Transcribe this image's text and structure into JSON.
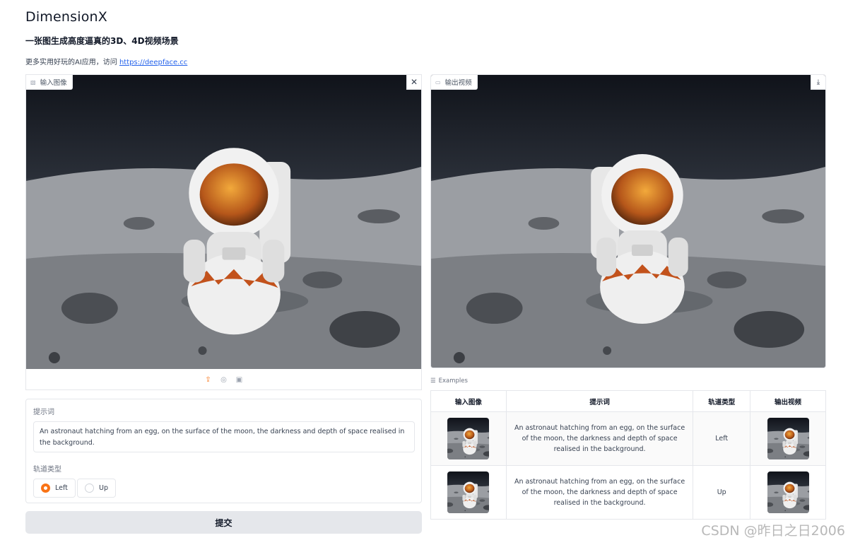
{
  "app": {
    "title": "DimensionX",
    "subtitle": "一张图生成高度逼真的3D、4D视频场景",
    "more_prefix": "更多实用好玩的AI应用，访问 ",
    "more_link": "https://deepface.cc"
  },
  "input_panel": {
    "label": "输入图像",
    "icon": "image-icon",
    "clear_icon": "close-icon"
  },
  "output_panel": {
    "label": "输出视频",
    "icon": "video-icon",
    "download_icon": "download-icon"
  },
  "toolbar": {
    "icons": [
      "upload-icon",
      "webcam-icon",
      "clipboard-icon"
    ]
  },
  "prompt": {
    "label": "提示词",
    "value": "An astronaut hatching from an egg, on the surface of the moon, the darkness and depth of space realised in the background."
  },
  "trajectory": {
    "label": "轨道类型",
    "options": [
      "Left",
      "Up"
    ],
    "selected": "Left"
  },
  "submit_label": "提交",
  "examples": {
    "label": "Examples",
    "headers": [
      "输入图像",
      "提示词",
      "轨道类型",
      "输出视频"
    ],
    "rows": [
      {
        "prompt": "An astronaut hatching from an egg, on the surface of the moon, the darkness and depth of space realised in the background.",
        "trajectory": "Left"
      },
      {
        "prompt": "An astronaut hatching from an egg, on the surface of the moon, the darkness and depth of space realised in the background.",
        "trajectory": "Up"
      }
    ]
  },
  "watermark": "CSDN @昨日之日2006",
  "colors": {
    "accent": "#f97316",
    "link": "#2563eb",
    "button_bg": "#e5e7eb"
  }
}
